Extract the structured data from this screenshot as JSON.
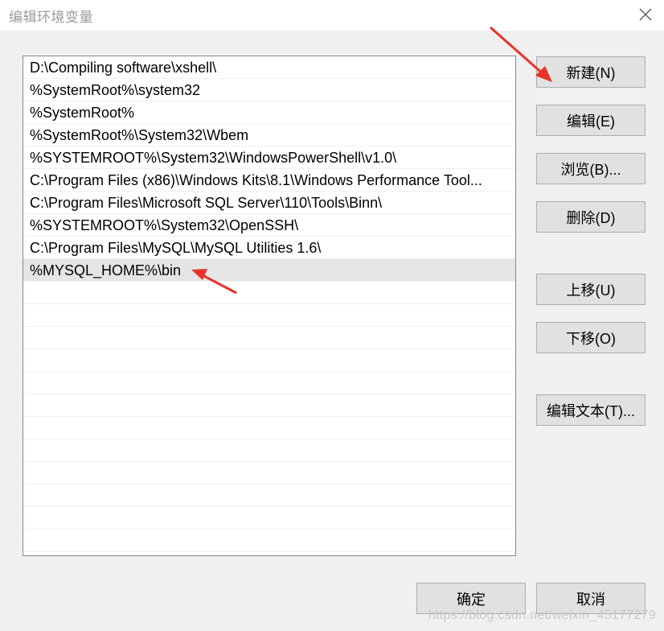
{
  "window": {
    "title": "编辑环境变量",
    "close_icon": "close-icon"
  },
  "path_list": {
    "items": [
      "D:\\Compiling software\\xshell\\",
      "%SystemRoot%\\system32",
      "%SystemRoot%",
      "%SystemRoot%\\System32\\Wbem",
      "%SYSTEMROOT%\\System32\\WindowsPowerShell\\v1.0\\",
      "C:\\Program Files (x86)\\Windows Kits\\8.1\\Windows Performance Tool...",
      "C:\\Program Files\\Microsoft SQL Server\\110\\Tools\\Binn\\",
      "%SYSTEMROOT%\\System32\\OpenSSH\\",
      "C:\\Program Files\\MySQL\\MySQL Utilities 1.6\\",
      "%MYSQL_HOME%\\bin"
    ],
    "selected_index": 9
  },
  "buttons": {
    "new": "新建(N)",
    "edit": "编辑(E)",
    "browse": "浏览(B)...",
    "delete": "删除(D)",
    "move_up": "上移(U)",
    "move_down": "下移(O)",
    "edit_text": "编辑文本(T)...",
    "ok": "确定",
    "cancel": "取消"
  },
  "annotations": {
    "arrow_color": "#e8332a"
  },
  "watermark": "https://blog.csdn.net/weixin_45177279"
}
